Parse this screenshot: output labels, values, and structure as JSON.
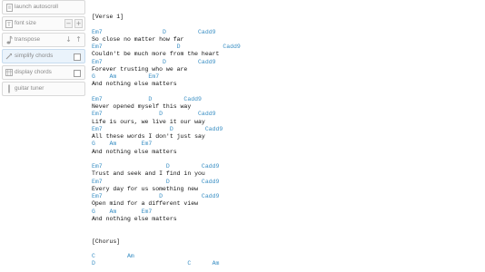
{
  "toolbar": {
    "items": [
      {
        "label": "launch autoscroll",
        "icon": "autoscroll-icon"
      },
      {
        "label": "font size",
        "icon": "font-size-icon",
        "minus": "−",
        "plus": "+"
      },
      {
        "label": "transpose",
        "icon": "music-note-icon",
        "down": "↓",
        "up": "↑"
      },
      {
        "label": "simplify chords",
        "icon": "simplify-icon",
        "checked": false
      },
      {
        "label": "display chords",
        "icon": "display-chords-icon",
        "checked": false
      },
      {
        "label": "guitar tuner",
        "icon": "tuner-icon"
      }
    ]
  },
  "colors": {
    "chord": "#3a8fc4",
    "lyric": "#111111",
    "panel_text": "#8a8a8a",
    "active_bg": "#eaf3fb"
  },
  "song": {
    "lines": [
      {
        "type": "section",
        "text": "[Verse 1]"
      },
      {
        "type": "gap",
        "text": ""
      },
      {
        "type": "chord",
        "text": "Em7                 D         Cadd9"
      },
      {
        "type": "lyric",
        "text": "So close no matter how far"
      },
      {
        "type": "chord",
        "text": "Em7                     D            Cadd9"
      },
      {
        "type": "lyric",
        "text": "Couldn't be much more from the heart"
      },
      {
        "type": "chord",
        "text": "Em7                 D         Cadd9"
      },
      {
        "type": "lyric",
        "text": "Forever trusting who we are"
      },
      {
        "type": "chord",
        "text": "G    Am         Em7"
      },
      {
        "type": "lyric",
        "text": "And nothing else matters"
      },
      {
        "type": "gap",
        "text": ""
      },
      {
        "type": "chord",
        "text": "Em7             D         Cadd9"
      },
      {
        "type": "lyric",
        "text": "Never opened myself this way"
      },
      {
        "type": "chord",
        "text": "Em7                D          Cadd9"
      },
      {
        "type": "lyric",
        "text": "Life is ours, we live it our way"
      },
      {
        "type": "chord",
        "text": "Em7                   D         Cadd9"
      },
      {
        "type": "lyric",
        "text": "All these words I don't just say"
      },
      {
        "type": "chord",
        "text": "G    Am       Em7"
      },
      {
        "type": "lyric",
        "text": "And nothing else matters"
      },
      {
        "type": "gap",
        "text": ""
      },
      {
        "type": "chord",
        "text": "Em7                  D         Cadd9"
      },
      {
        "type": "lyric",
        "text": "Trust and seek and I find in you"
      },
      {
        "type": "chord",
        "text": "Em7                  D         Cadd9"
      },
      {
        "type": "lyric",
        "text": "Every day for us something new"
      },
      {
        "type": "chord",
        "text": "Em7                D           Cadd9"
      },
      {
        "type": "lyric",
        "text": "Open mind for a different view"
      },
      {
        "type": "chord",
        "text": "G    Am       Em7"
      },
      {
        "type": "lyric",
        "text": "And nothing else matters"
      },
      {
        "type": "gap",
        "text": ""
      },
      {
        "type": "gap",
        "text": ""
      },
      {
        "type": "section",
        "text": "[Chorus]"
      },
      {
        "type": "gap",
        "text": ""
      },
      {
        "type": "chord",
        "text": "C         Am"
      },
      {
        "type": "chord",
        "text": "D                          C      Am"
      }
    ]
  }
}
